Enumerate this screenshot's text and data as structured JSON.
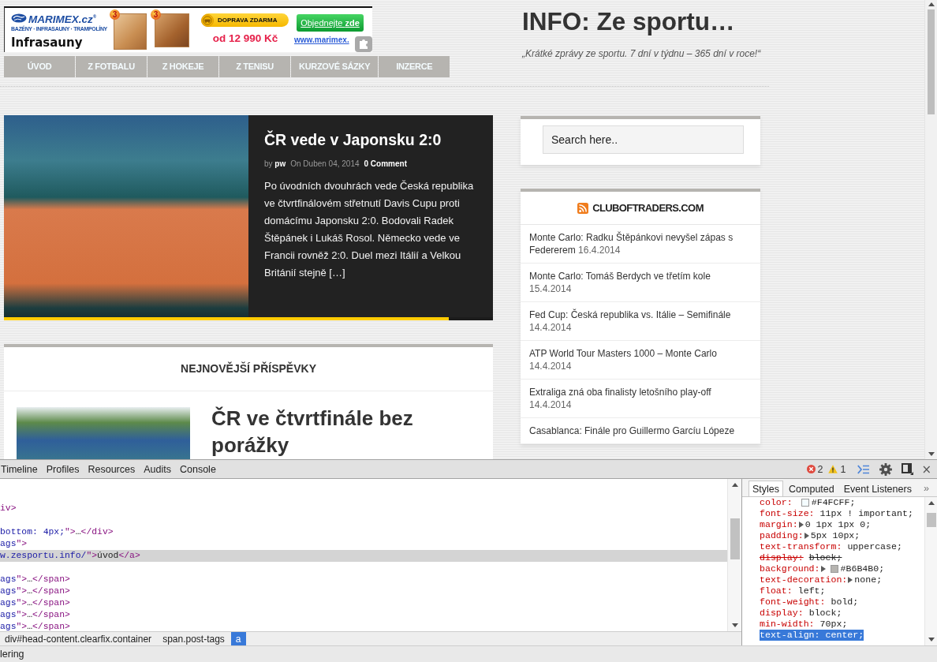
{
  "banner": {
    "brand": "MARIMEX.cz$^{®}$",
    "tagline": "BAZÉNY · INFRASAUNY · TRAMPOLÍNY",
    "product": "Infrasauny",
    "badges": [
      "3",
      "3"
    ],
    "shipping": "DOPRAVA ZDARMA",
    "price": "od 12 990 Kč",
    "order_button": "Objednejte **zde**",
    "url": "www.marimex."
  },
  "nav": [
    {
      "label": "ÚVOD"
    },
    {
      "label": "Z FOTBALU"
    },
    {
      "label": "Z HOKEJE"
    },
    {
      "label": "Z TENISU"
    },
    {
      "label": "KURZOVÉ SÁZKY"
    },
    {
      "label": "INZERCE"
    }
  ],
  "site": {
    "title": "INFO: Ze sportu…",
    "tagline": "„Krátké zprávy ze sportu. 7 dní v týdnu – 365 dní v roce!“"
  },
  "featured": {
    "title": "ČR vede v Japonsku 2:0",
    "byline": "by **pw**",
    "date": "On Duben 04, 2014",
    "comments": "0 Comment",
    "excerpt": "Po úvodních dvouhrách vede Česká republika ve čtvrtfinálovém střetnutí Davis Cupu proti domácímu Japonsku 2:0. Bodovali Radek Štěpánek i Lukáš Rosol. Německo vede ve Francii rovněž 2:0. Duel mezi Itálií a Velkou Británií stejně […]",
    "progress": {
      "level": 0.91
    }
  },
  "latest": {
    "heading": "NEJNOVĚJŠÍ PŘÍSPĚVKY",
    "posts": [
      {
        "title": "ČR ve čtvrtfinále bez porážky"
      }
    ]
  },
  "search": {
    "placeholder": "Search here.."
  },
  "feed": {
    "title": "CLUBOFTRADERS.COM",
    "items": [
      {
        "title": "Monte Carlo: Radku Štěpánkovi nevyšel zápas s Federerem",
        "date": "16.4.2014"
      },
      {
        "title": "Monte Carlo: Tomáš Berdych ve třetím kole",
        "date": "15.4.2014"
      },
      {
        "title": "Fed Cup: Česká republika vs. Itálie – Semifinále",
        "date": "14.4.2014"
      },
      {
        "title": "ATP World Tour Masters 1000 – Monte Carlo",
        "date": "14.4.2014"
      },
      {
        "title": "Extraliga zná oba finalisty letošního play-off",
        "date": "14.4.2014"
      },
      {
        "title": "Casablanca: Finále pro Guillermo Garcíu Lópeze"
      }
    ]
  },
  "devtools": {
    "tabs": [
      {
        "label": "Timeline",
        "selected": false
      },
      {
        "label": "Profiles",
        "selected": false
      },
      {
        "label": "Resources",
        "selected": false
      },
      {
        "label": "Audits",
        "selected": false
      },
      {
        "label": "Console",
        "selected": false
      }
    ],
    "errors": "2",
    "warnings": "1",
    "close": "×",
    "elements": {
      "blocks": [
        {
          "lines": [
            {
              "selected": false,
              "segments": [
                {
                  "kind": "tag",
                  "text": "iv>"
                }
              ]
            }
          ]
        },
        {
          "lines": [
            {
              "selected": false,
              "segments": [
                {
                  "kind": "value",
                  "text": "bottom: 4px;"
                },
                {
                  "kind": "tag",
                  "text": "\">"
                },
                {
                  "kind": "text",
                  "text": "…"
                },
                {
                  "kind": "tag",
                  "text": "</div>"
                }
              ]
            },
            {
              "selected": false,
              "segments": [
                {
                  "kind": "value",
                  "text": "ags"
                },
                {
                  "kind": "tag",
                  "text": "\">"
                }
              ]
            },
            {
              "selected": true,
              "segments": [
                {
                  "kind": "value",
                  "text": "w.zesportu.info/"
                },
                {
                  "kind": "tag",
                  "text": "\">"
                },
                {
                  "kind": "text",
                  "text": "úvod"
                },
                {
                  "kind": "tag",
                  "text": "</a>"
                }
              ]
            }
          ]
        },
        {
          "lines": [
            {
              "selected": false,
              "segments": [
                {
                  "kind": "value",
                  "text": "ags"
                },
                {
                  "kind": "tag",
                  "text": "\">"
                },
                {
                  "kind": "text",
                  "text": "…"
                },
                {
                  "kind": "tag",
                  "text": "</span>"
                }
              ]
            },
            {
              "selected": false,
              "segments": [
                {
                  "kind": "value",
                  "text": "ags"
                },
                {
                  "kind": "tag",
                  "text": "\">"
                },
                {
                  "kind": "text",
                  "text": "…"
                },
                {
                  "kind": "tag",
                  "text": "</span>"
                }
              ]
            },
            {
              "selected": false,
              "segments": [
                {
                  "kind": "value",
                  "text": "ags"
                },
                {
                  "kind": "tag",
                  "text": "\">"
                },
                {
                  "kind": "text",
                  "text": "…"
                },
                {
                  "kind": "tag",
                  "text": "</span>"
                }
              ]
            },
            {
              "selected": false,
              "segments": [
                {
                  "kind": "value",
                  "text": "ags"
                },
                {
                  "kind": "tag",
                  "text": "\">"
                },
                {
                  "kind": "text",
                  "text": "…"
                },
                {
                  "kind": "tag",
                  "text": "</span>"
                }
              ]
            },
            {
              "selected": false,
              "segments": [
                {
                  "kind": "value",
                  "text": "ags"
                },
                {
                  "kind": "tag",
                  "text": "\">"
                },
                {
                  "kind": "text",
                  "text": "…"
                },
                {
                  "kind": "tag",
                  "text": "</span>"
                }
              ]
            }
          ]
        }
      ],
      "breadcrumbs": [
        {
          "label": "div#head-content.clearfix.container",
          "selected": false
        },
        {
          "label": "span.post-tags",
          "selected": false
        },
        {
          "label": "a",
          "selected": true
        }
      ]
    },
    "styles": {
      "tabs": [
        {
          "label": "Styles",
          "selected": true
        },
        {
          "label": "Computed",
          "selected": false
        },
        {
          "label": "Event Listeners",
          "selected": false
        }
      ],
      "more": "»",
      "properties": [
        {
          "name": "color:",
          "value": "#F4FCFF;",
          "color": "#f4fcff",
          "expandable": false,
          "overridden": false,
          "selected": false
        },
        {
          "name": "font-size:",
          "value": "11px ! important;",
          "expandable": false,
          "overridden": false,
          "selected": false
        },
        {
          "name": "margin:",
          "value": "0 1px 1px 0;",
          "expandable": true,
          "overridden": false,
          "selected": false
        },
        {
          "name": "padding:",
          "value": "5px 10px;",
          "expandable": true,
          "overridden": false,
          "selected": false
        },
        {
          "name": "text-transform:",
          "value": "uppercase;",
          "expandable": false,
          "overridden": false,
          "selected": false
        },
        {
          "name": "display:",
          "value": "block;",
          "expandable": false,
          "overridden": true,
          "selected": false
        },
        {
          "name": "background:",
          "value": "#B6B4B0;",
          "color": "#b6b4b0",
          "expandable": true,
          "overridden": false,
          "selected": false
        },
        {
          "name": "text-decoration:",
          "value": "none;",
          "expandable": true,
          "overridden": false,
          "selected": false
        },
        {
          "name": "float:",
          "value": "left;",
          "expandable": false,
          "overridden": false,
          "selected": false
        },
        {
          "name": "font-weight:",
          "value": "bold;",
          "expandable": false,
          "overridden": false,
          "selected": false
        },
        {
          "name": "display:",
          "value": "block;",
          "expandable": false,
          "overridden": false,
          "selected": false
        },
        {
          "name": "min-width:",
          "value": "70px;",
          "expandable": false,
          "overridden": false,
          "selected": false
        },
        {
          "name": "text-align:",
          "value": "center;",
          "expandable": false,
          "overridden": false,
          "selected": true
        }
      ]
    },
    "status": "lering"
  }
}
